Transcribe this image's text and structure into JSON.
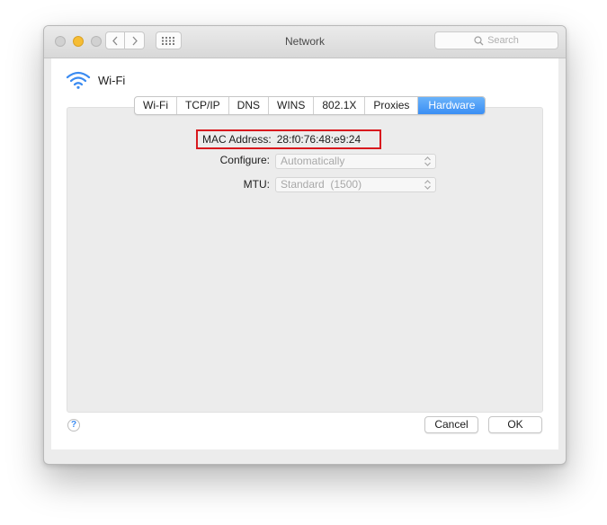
{
  "window": {
    "title": "Network",
    "search_placeholder": "Search"
  },
  "interface": {
    "name": "Wi-Fi",
    "icon": "wifi-icon",
    "accent_color": "#3b8bf1"
  },
  "tabs": [
    {
      "label": "Wi-Fi",
      "active": false
    },
    {
      "label": "TCP/IP",
      "active": false
    },
    {
      "label": "DNS",
      "active": false
    },
    {
      "label": "WINS",
      "active": false
    },
    {
      "label": "802.1X",
      "active": false
    },
    {
      "label": "Proxies",
      "active": false
    },
    {
      "label": "Hardware",
      "active": true
    }
  ],
  "hardware": {
    "mac_label": "MAC Address:",
    "mac_value": "28:f0:76:48:e9:24",
    "highlight_color": "#d8191e",
    "configure_label": "Configure:",
    "configure_value": "Automatically",
    "mtu_label": "MTU:",
    "mtu_value": "Standard  (1500)"
  },
  "footer": {
    "help_label": "?",
    "cancel_label": "Cancel",
    "ok_label": "OK"
  }
}
